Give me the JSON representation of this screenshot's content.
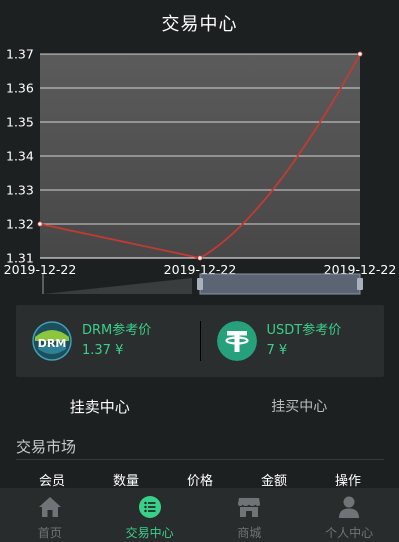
{
  "header": {
    "title": "交易中心"
  },
  "chart_data": {
    "type": "line",
    "x": [
      "2019-12-22",
      "2019-12-22",
      "2019-12-22"
    ],
    "series": [
      {
        "values": [
          1.32,
          1.31,
          1.37
        ]
      }
    ],
    "y_ticks": [
      "1.37",
      "1.36",
      "1.35",
      "1.34",
      "1.33",
      "1.32",
      "1.31"
    ],
    "x_ticks": [
      "2019-12-22",
      "2019-12-22",
      "2019-12-22"
    ],
    "ylim": [
      1.31,
      1.37
    ],
    "grid": true,
    "colors": {
      "line": "#c43a32",
      "point": "#ffffff",
      "plot_bg_top": "#5b5b5b",
      "plot_bg_bottom": "#474747"
    }
  },
  "price_card": {
    "items": [
      {
        "name": "DRM参考价",
        "price": "1.37 ¥",
        "logo_text": "DRM",
        "icon": "drm-logo"
      },
      {
        "name": "USDT参考价",
        "price": "7 ¥",
        "logo_text": "T",
        "icon": "tether-logo"
      }
    ]
  },
  "tabs": [
    {
      "label": "挂卖中心",
      "active": true
    },
    {
      "label": "挂买中心",
      "active": false
    }
  ],
  "market": {
    "title": "交易市场",
    "columns": [
      "会员",
      "数量",
      "价格",
      "金额",
      "操作"
    ]
  },
  "bottom_nav": [
    {
      "label": "首页",
      "icon": "home-icon",
      "active": false
    },
    {
      "label": "交易中心",
      "icon": "list-icon",
      "active": true
    },
    {
      "label": "商城",
      "icon": "shop-icon",
      "active": false
    },
    {
      "label": "个人中心",
      "icon": "user-icon",
      "active": false
    }
  ],
  "colors": {
    "accent": "#3bd08a",
    "background": "#1d2021",
    "card": "#2a2e2f",
    "nav_bg": "#282c2d",
    "nav_inactive": "#6f7476"
  }
}
